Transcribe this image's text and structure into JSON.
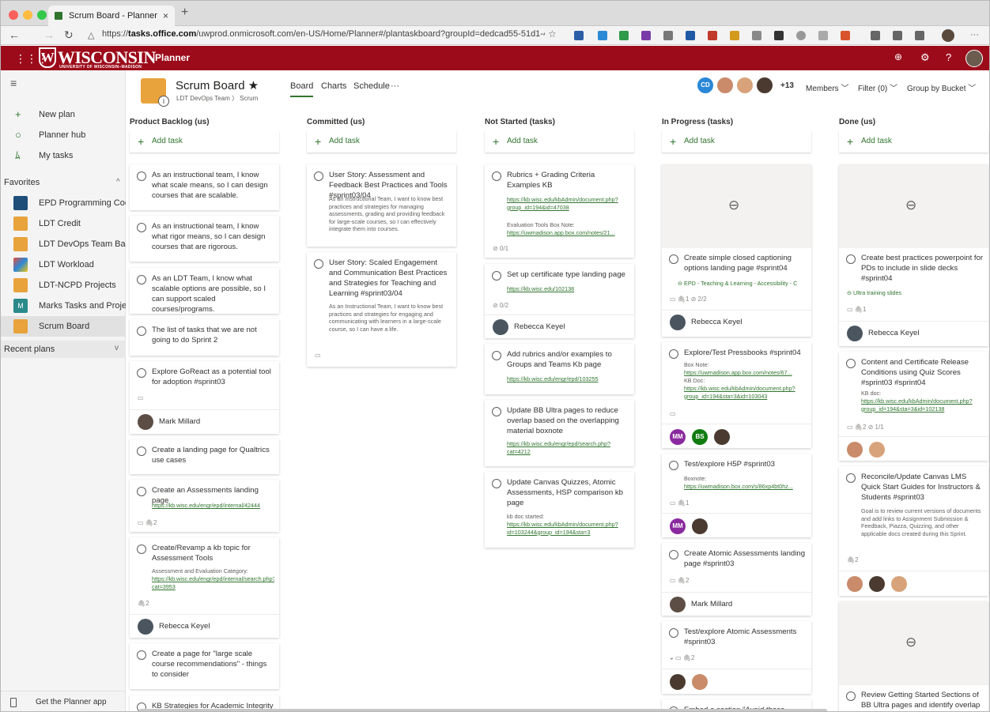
{
  "browser": {
    "tab_title": "Scrum Board - Planner",
    "tab_close": "×",
    "new_tab": "+",
    "url_prefix": "https://",
    "url_host": "tasks.office.com",
    "url_path": "/uwprod.onmicrosoft.com/en-US/Home/Planner#/plantaskboard?groupId=dedcad55-51d1-4c43-9efd...",
    "back": "←",
    "forward": "→",
    "reload": "↻",
    "star": "☆",
    "more": "···"
  },
  "suite": {
    "waffle": "⋮⋮⋮",
    "logo_text": "WISCONSIN",
    "logo_mark": "W",
    "logo_sub": "UNIVERSITY OF WISCONSIN–MADISON",
    "app_name": "Planner",
    "bell": "🔔",
    "settings": "⚙",
    "help": "?"
  },
  "sidebar": {
    "menu": "≡",
    "nav": [
      {
        "icon": "+",
        "label": "New plan"
      },
      {
        "icon": "○",
        "label": "Planner hub"
      },
      {
        "icon": "ﾑ",
        "label": "My tasks"
      }
    ],
    "favorites_label": "Favorites",
    "favorites_chev": "^",
    "favorites": [
      {
        "label": "EPD Programming Coor...",
        "color": "#1f4e79"
      },
      {
        "label": "LDT Credit",
        "color": "#e8a33c"
      },
      {
        "label": "LDT DevOps Team Backl...",
        "color": "#e8a33c"
      },
      {
        "label": "LDT Workload",
        "color": "#2b88d8"
      },
      {
        "label": "LDT-NCPD Projects",
        "color": "#e8a33c"
      },
      {
        "label": "Marks Tasks and Projects",
        "color": "#2b8a8a",
        "initial": "M"
      },
      {
        "label": "Scrum Board",
        "color": "#e8a33c"
      }
    ],
    "recent_label": "Recent plans",
    "recent_chev": "v",
    "footer": "Get the Planner app"
  },
  "header": {
    "plan_title": "Scrum Board",
    "star": "★",
    "breadcrumb": "LDT DevOps Team  〉 Scrum",
    "info": "i",
    "tabs": [
      "Board",
      "Charts",
      "Schedule",
      "···"
    ],
    "member_initials": "CD",
    "member_more": "+13",
    "members": "Members",
    "filter": "Filter (0)",
    "group": "Group by Bucket",
    "chev": "﹀"
  },
  "add_task": "Add task",
  "buckets": [
    {
      "title": "Product Backlog (us)",
      "cards": [
        {
          "title": "As an instructional team, I know what scale means, so I can design courses that are scalable."
        },
        {
          "title": "As an instructional team, I know what rigor means, so I can design courses that are rigorous."
        },
        {
          "title": "As an LDT Team, I know what scalable options are possible, so I can support scaled courses/programs."
        },
        {
          "title": "The list of tasks that we are not going to do Sprint 2"
        },
        {
          "title": "Explore GoReact as a potential tool for adoption #sprint03",
          "meta": "▭",
          "assignee": "Mark Millard"
        },
        {
          "title": "Create a landing page for Qualtrics use cases"
        },
        {
          "title": "Create an Assessments landing page",
          "link": "https://kb.wisc.edu/engr/epd/internal/42444",
          "meta": "▭   🖇2"
        },
        {
          "title": "Create/Revamp a kb topic for Assessment Tools",
          "desc": "Assessment and Evaluation Category:",
          "link": "https://kb.wisc.edu/engr/epd/internal/search.php?cat=3953",
          "meta": "🖇2",
          "assignee": "Rebecca Keyel"
        },
        {
          "title": "Create a page for \"large scale course recommendations\" - things to consider"
        },
        {
          "title": "KB Strategies for Academic Integrity"
        }
      ]
    },
    {
      "title": "Committed (us)",
      "cards": [
        {
          "title": "User Story: Assessment and Feedback Best Practices and Tools #sprint03/04",
          "desc": "As an Instructional Team, I want to know best practices and strategies for managing assessments, grading and providing feedback for large-scale courses, so I can effectively integrate them into courses."
        },
        {
          "title": "User Story: Scaled Engagement and Communication Best Practices and Strategies for Teaching and Learning #sprint03/04",
          "desc": "As an Instructional Team, I want to know best practices and strategies for engaging and communicating with learners in a large-scale course, so I can have a life.",
          "meta": "▭"
        }
      ]
    },
    {
      "title": "Not Started (tasks)",
      "cards": [
        {
          "title": "Rubrics + Grading Criteria Examples KB",
          "link": "https://kb.wisc.edu/kbAdmin/document.php?group_id=194&id=47038",
          "desc": "Evaluation Tools Box Note:",
          "link2": "https://uwmadison.app.box.com/notes/21...",
          "meta": "⊘ 0/1"
        },
        {
          "title": "Set up certificate type landing page",
          "link": "https://kb.wisc.edu/102138",
          "meta": "⊘ 0/2",
          "assignee": "Rebecca Keyel"
        },
        {
          "title": "Add rubrics and/or examples to Groups and Teams Kb page",
          "link": "https://kb.wisc.edu/engr/epd/103255"
        },
        {
          "title": "Update BB Ultra pages to reduce overlap based on the overlapping material boxnote",
          "link": "https://kb.wisc.edu/engr/epd/search.php?cat=4212"
        },
        {
          "title": "Update Canvas Quizzes, Atomic Assessments, HSP comparison kb page",
          "desc": "kb doc started:",
          "link": "https://kb.wisc.edu/kbAdmin/document.php?id=103244&group_id=194&sta=3"
        }
      ]
    },
    {
      "title": "In Progress (tasks)",
      "cards": [
        {
          "title": "Create simple closed captioning options landing page #sprint04",
          "desc": "EPD - Teaching & Learning - Accessibility - C",
          "meta": "▭   🖇1   ⊘ 2/2",
          "assignee": "Rebecca Keyel"
        },
        {
          "title": "Explore/Test Pressbooks #sprint04",
          "desc": "Box Note:",
          "link": "https://uwmadison.app.box.com/notes/67...",
          "desc2": "KB Doc:",
          "link2": "https://kb.wisc.edu/kbAdmin/document.php?group_id=194&sta=3&id=103043",
          "meta": "▭",
          "bubbles": [
            "MM",
            "BS"
          ]
        },
        {
          "title": "Test/explore H5P #sprint03",
          "desc": "Boxnote:",
          "link": "https://uwmadison.box.com/s/86xp4bt0hz...",
          "meta": "▭   🖇1",
          "bubbles": [
            "MM"
          ]
        },
        {
          "title": "Create Atomic Assessments landing page #sprint03",
          "meta": "▭   🖇2",
          "assignee": "Mark Millard"
        },
        {
          "title": "Test/explore Atomic Assessments #sprint03",
          "meta": "◒   ▭   🖇2"
        },
        {
          "title": "Embed a section \"Avoid these Pitfalls\""
        }
      ]
    },
    {
      "title": "Done (us)",
      "cards": [
        {
          "title": "Create best practices powerpoint for PDs to include in slide decks #sprint04",
          "desc": "Ultra training slides",
          "meta": "▭   🖇1",
          "assignee": "Rebecca Keyel"
        },
        {
          "title": "Content and Certificate Release Conditions using Quiz Scores #sprint03 #sprint04",
          "desc": "KB doc:",
          "link": "https://kb.wisc.edu/kbAdmin/document.php?group_id=194&sta=3&id=102138",
          "meta": "▭   🖇2   ⊘ 1/1"
        },
        {
          "title": "Reconcile/Update Canvas LMS Quick Start Guides for Instructors & Students #sprint03",
          "desc": "Goal is to review current versions of documents and add links to Assignment Submission & Feedback, Piazza, Quizzing, and other applicable docs created during this Sprint.",
          "meta": "🖇2"
        },
        {
          "title": "Review Getting Started Sections of BB Ultra pages and identify overlap"
        }
      ]
    }
  ],
  "preview_icon": "⊖"
}
